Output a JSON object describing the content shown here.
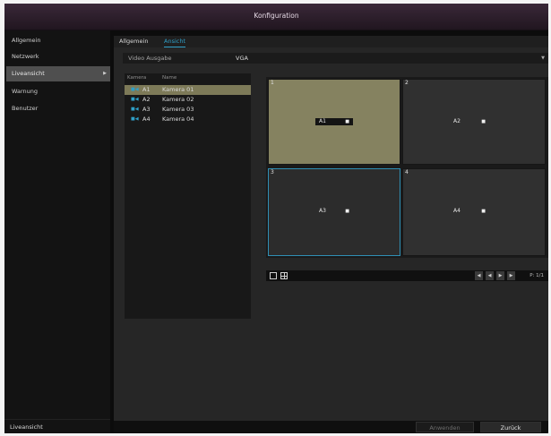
{
  "window": {
    "title": "Konfiguration"
  },
  "sidebar": {
    "items": [
      {
        "label": "Allgemein"
      },
      {
        "label": "Netzwerk"
      },
      {
        "label": "Liveansicht",
        "active": true
      },
      {
        "label": "Warnung"
      },
      {
        "label": "Benutzer"
      }
    ],
    "active_arrow_icon": "triangle-right-icon",
    "footer_label": "Liveansicht"
  },
  "tabs": [
    {
      "label": "Allgemein"
    },
    {
      "label": "Ansicht",
      "active": true
    }
  ],
  "video_output": {
    "label": "Video Ausgabe",
    "value": "VGA",
    "dropdown_icon": "chevron-down-icon"
  },
  "camera_list": {
    "headers": {
      "camera": "Kamera",
      "name": "Name"
    },
    "rows": [
      {
        "id": "A1",
        "name": "Kamera 01",
        "selected": true
      },
      {
        "id": "A2",
        "name": "Kamera 02",
        "selected": false
      },
      {
        "id": "A3",
        "name": "Kamera 03",
        "selected": false
      },
      {
        "id": "A4",
        "name": "Kamera 04",
        "selected": false
      }
    ],
    "row_icon": "camera-icon"
  },
  "layout_grid": {
    "cells": [
      {
        "number": "1",
        "camera": "A1"
      },
      {
        "number": "2",
        "camera": "A2"
      },
      {
        "number": "3",
        "camera": "A3"
      },
      {
        "number": "4",
        "camera": "A4"
      }
    ],
    "selected_cell_color": "#858260",
    "focus_border_color": "#2f8fb5"
  },
  "grid_toolbar": {
    "layout_1x1_icon": "single-window-icon",
    "layout_2x2_icon": "quad-window-icon",
    "nav_icons": [
      "first-page-icon",
      "prev-page-icon",
      "next-page-icon",
      "last-page-icon"
    ],
    "page_label": "P: 1/1"
  },
  "buttons": {
    "apply": "Anwenden",
    "back": "Zurück"
  },
  "colors": {
    "accent": "#2f9fc7",
    "title_bar": "#2f202d"
  }
}
